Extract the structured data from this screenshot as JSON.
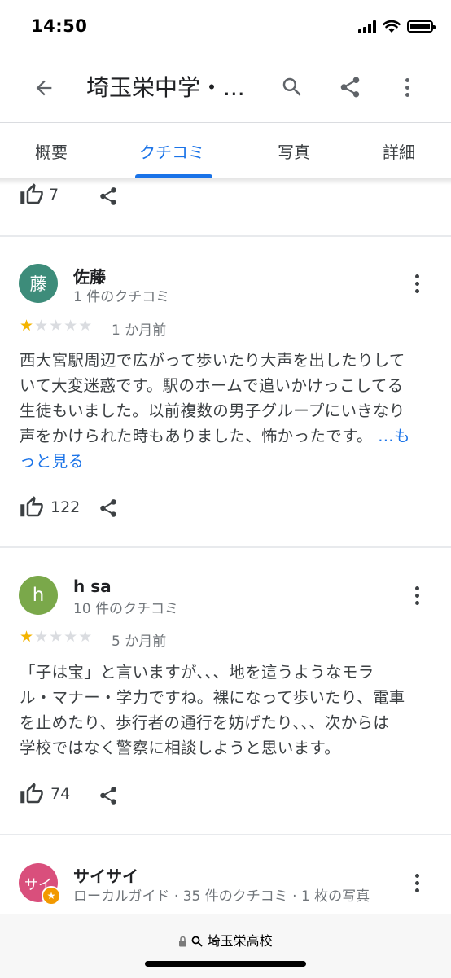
{
  "status_bar": {
    "time": "14:50"
  },
  "app_bar": {
    "title": "埼玉栄中学・..."
  },
  "tabs": [
    {
      "label": "概要"
    },
    {
      "label": "クチコミ"
    },
    {
      "label": "写真"
    },
    {
      "label": "詳細"
    }
  ],
  "reviews": [
    {
      "likes": "7"
    },
    {
      "avatar_letter": "藤",
      "avatar_color": "#3d8c7a",
      "name": "佐藤",
      "review_count": "1 件のクチコミ",
      "rating": 1,
      "date": "1 か月前",
      "text_lines": [
        "西大宮駅周辺で広がって歩いたり大声を出したりして",
        "いて大変迷惑です。駅のホームで追いかけっこしてる",
        "生徒もいました。以前複数の男子グループにいきなり",
        "声をかけられた時もありました、怖かったです。 "
      ],
      "more_a": "…も",
      "more_b": "っと見る",
      "likes": "122"
    },
    {
      "avatar_letter": "h",
      "avatar_color": "#7aa84a",
      "name": "h sa",
      "review_count": "10 件のクチコミ",
      "rating": 1,
      "date": "5 か月前",
      "text_lines": [
        "「子は宝」と言いますが、、、地を這うようなモラ",
        "ル・マナー・学力ですね。裸になって歩いたり、電車",
        "を止めたり、歩行者の通行を妨げたり、、、次からは",
        "学校ではなく警察に相談しようと思います。"
      ],
      "likes": "74"
    },
    {
      "avatar_letter": "サイ",
      "avatar_color": "#d94f7c",
      "name": "サイサイ",
      "review_count": "ローカルガイド · 35 件のクチコミ · 1 枚の写真"
    }
  ],
  "bottom_bar": {
    "url": "埼玉栄高校"
  },
  "icons": {
    "back": "arrow-left-icon",
    "search": "search-icon",
    "share": "share-icon",
    "more": "more-vert-icon",
    "like": "thumb-up-icon",
    "lock": "lock-icon",
    "local_guide": "local-guide-badge-icon"
  },
  "colors": {
    "accent": "#1a73e8",
    "star": "#f4b400"
  }
}
